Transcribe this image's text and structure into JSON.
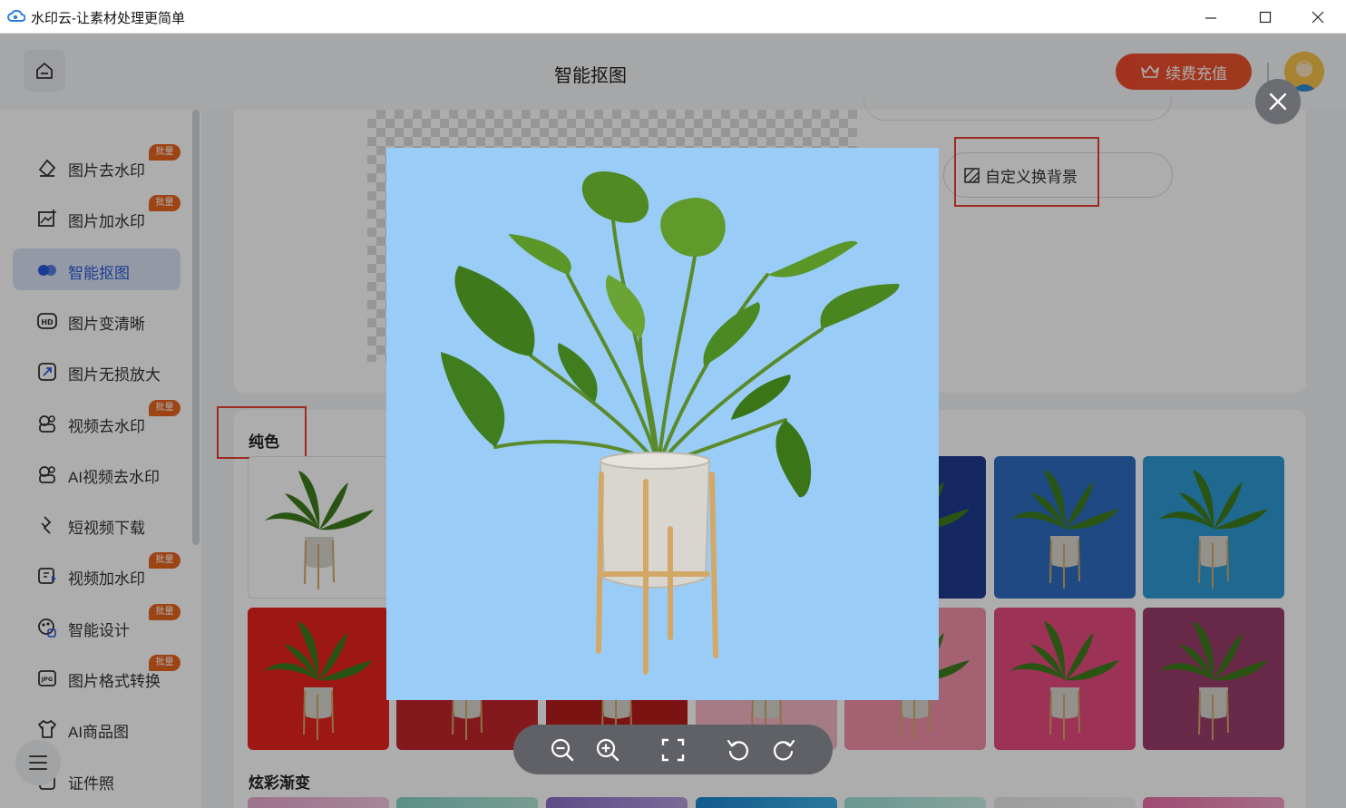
{
  "window": {
    "title": "水印云-让素材处理更简单"
  },
  "header": {
    "page_title": "智能抠图",
    "renew_label": "续费充值"
  },
  "sidebar": {
    "items": [
      {
        "label": "图片去水印",
        "badge": "批量",
        "icon": "eraser-icon"
      },
      {
        "label": "图片加水印",
        "badge": "批量",
        "icon": "image-add-icon"
      },
      {
        "label": "智能抠图",
        "badge": "",
        "icon": "cutout-icon",
        "active": true
      },
      {
        "label": "图片变清晰",
        "badge": "",
        "icon": "hd-icon"
      },
      {
        "label": "图片无损放大",
        "badge": "",
        "icon": "enlarge-icon"
      },
      {
        "label": "视频去水印",
        "badge": "批量",
        "icon": "video-eraser-icon"
      },
      {
        "label": "AI视频去水印",
        "badge": "",
        "icon": "ai-video-icon"
      },
      {
        "label": "短视频下载",
        "badge": "",
        "icon": "download-icon"
      },
      {
        "label": "视频加水印",
        "badge": "批量",
        "icon": "video-add-icon"
      },
      {
        "label": "智能设计",
        "badge": "批量",
        "icon": "design-icon"
      },
      {
        "label": "图片格式转换",
        "badge": "批量",
        "icon": "jpg-icon"
      },
      {
        "label": "AI商品图",
        "badge": "",
        "icon": "shirt-icon"
      },
      {
        "label": "证件照",
        "badge": "",
        "icon": "id-photo-icon"
      }
    ]
  },
  "editor": {
    "custom_bg_label": "自定义换背景",
    "section_solid": "纯色",
    "section_gradient": "炫彩渐变",
    "solid_colors": [
      "#ffffff",
      "#1f3a8f",
      "#2d6cc0",
      "#2f9bd6",
      "#e8231e",
      "#c3252b",
      "#b71c1c",
      "#f3b6c4",
      "#f08fa8",
      "#e64b7e",
      "#9b3f6c"
    ]
  },
  "preview": {
    "background": "#99cdf7",
    "tools": [
      "zoom-out-icon",
      "zoom-in-icon",
      "fit-screen-icon",
      "rotate-left-icon",
      "rotate-right-icon"
    ]
  }
}
